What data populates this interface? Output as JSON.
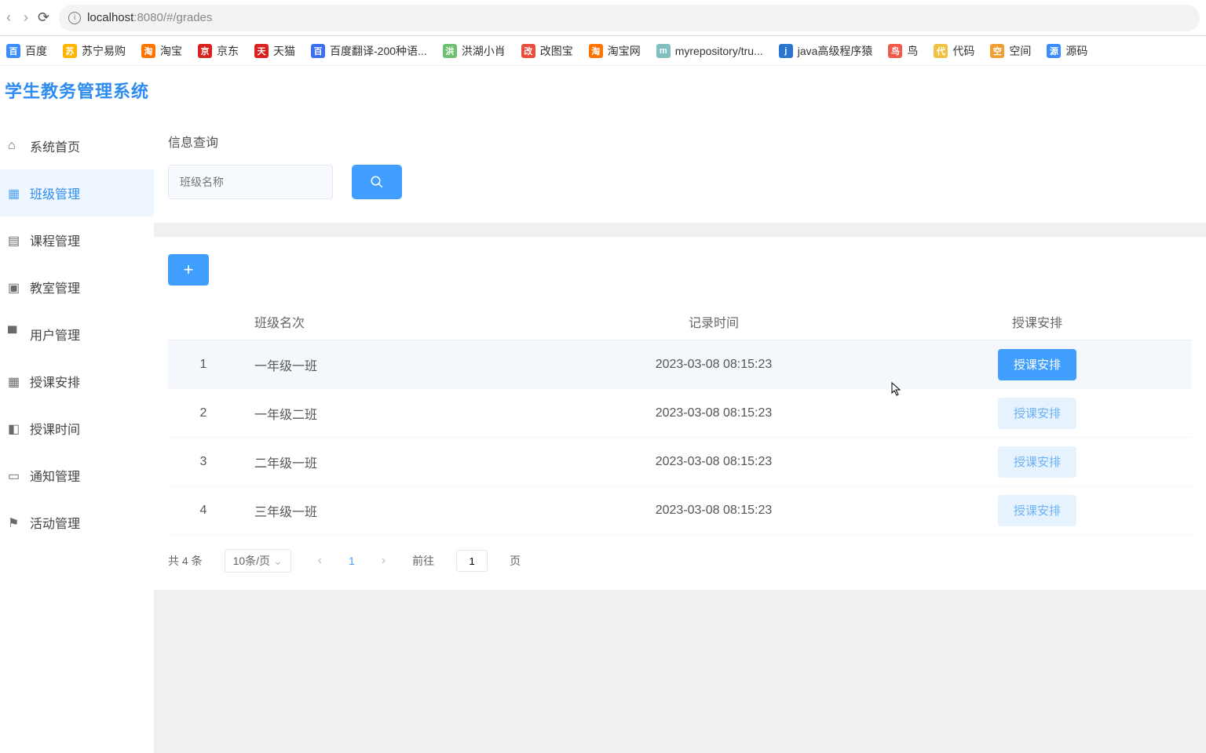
{
  "browser": {
    "url_host": "localhost",
    "url_port": ":8080",
    "url_path": "/#/grades"
  },
  "bookmarks": [
    {
      "label": "百度",
      "color": "#3b8cff"
    },
    {
      "label": "苏宁易购",
      "color": "#ffb400"
    },
    {
      "label": "淘宝",
      "color": "#ff7300"
    },
    {
      "label": "京东",
      "color": "#d9211f"
    },
    {
      "label": "天猫",
      "color": "#d9211f"
    },
    {
      "label": "百度翻译-200种语...",
      "color": "#3b6ef0"
    },
    {
      "label": "洪湖小肖",
      "color": "#6cc070"
    },
    {
      "label": "改图宝",
      "color": "#e84d3d"
    },
    {
      "label": "淘宝网",
      "color": "#ff7300"
    },
    {
      "label": "myrepository/tru...",
      "color": "#7fbfbf"
    },
    {
      "label": "java高级程序猿",
      "color": "#2b74d0"
    },
    {
      "label": "鸟",
      "color": "#f05a4a"
    },
    {
      "label": "代码",
      "color": "#f0c040"
    },
    {
      "label": "空间",
      "color": "#f0a030"
    },
    {
      "label": "源码",
      "color": "#3b8cff"
    }
  ],
  "app": {
    "title": "学生教务管理系统"
  },
  "sidebar": {
    "items": [
      {
        "icon": "home",
        "label": "系统首页"
      },
      {
        "icon": "grid",
        "label": "班级管理"
      },
      {
        "icon": "book",
        "label": "课程管理"
      },
      {
        "icon": "room",
        "label": "教室管理"
      },
      {
        "icon": "user",
        "label": "用户管理"
      },
      {
        "icon": "calendar",
        "label": "授课安排"
      },
      {
        "icon": "bell",
        "label": "授课时间"
      },
      {
        "icon": "notice",
        "label": "通知管理"
      },
      {
        "icon": "flag",
        "label": "活动管理"
      }
    ],
    "active_index": 1
  },
  "search": {
    "panel_title": "信息查询",
    "placeholder": "班级名称"
  },
  "table": {
    "headers": {
      "idx": "",
      "name": "班级名次",
      "time": "记录时间",
      "act": "授课安排"
    },
    "rows": [
      {
        "idx": "1",
        "name": "一年级一班",
        "time": "2023-03-08 08:15:23",
        "act": "授课安排",
        "hover": true
      },
      {
        "idx": "2",
        "name": "一年级二班",
        "time": "2023-03-08 08:15:23",
        "act": "授课安排",
        "hover": false
      },
      {
        "idx": "3",
        "name": "二年级一班",
        "time": "2023-03-08 08:15:23",
        "act": "授课安排",
        "hover": false
      },
      {
        "idx": "4",
        "name": "三年级一班",
        "time": "2023-03-08 08:15:23",
        "act": "授课安排",
        "hover": false
      }
    ]
  },
  "pager": {
    "total": "共 4 条",
    "per_page": "10条/页",
    "current": "1",
    "goto_label": "前往",
    "goto_value": "1",
    "page_suffix": "页"
  }
}
